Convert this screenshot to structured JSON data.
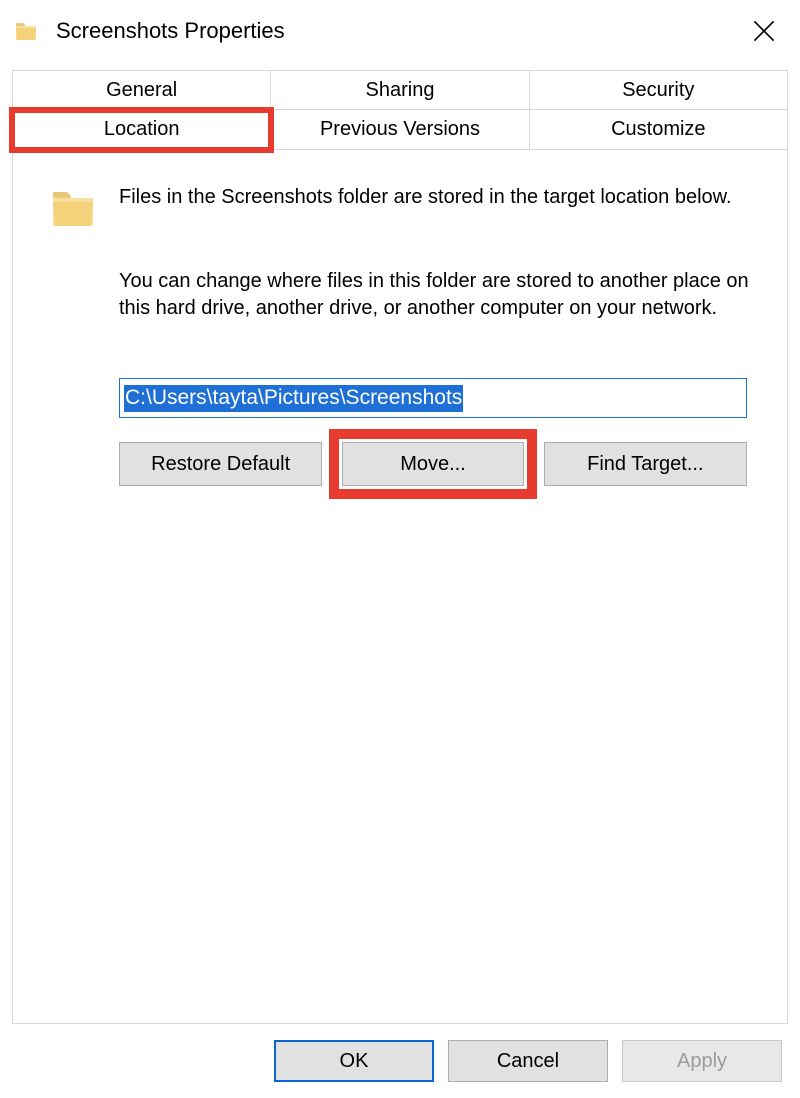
{
  "titlebar": {
    "title": "Screenshots Properties"
  },
  "tabs": {
    "row1": [
      {
        "id": "general",
        "label": "General"
      },
      {
        "id": "sharing",
        "label": "Sharing"
      },
      {
        "id": "security",
        "label": "Security"
      }
    ],
    "row2": [
      {
        "id": "location",
        "label": "Location"
      },
      {
        "id": "previous-versions",
        "label": "Previous Versions"
      },
      {
        "id": "customize",
        "label": "Customize"
      }
    ],
    "active": "location"
  },
  "content": {
    "intro": "Files in the Screenshots folder are stored in the target location below.",
    "description": "You can change where files in this folder are stored to another place on this hard drive, another drive, or another computer on your network.",
    "path_value": "C:\\Users\\tayta\\Pictures\\Screenshots",
    "buttons": {
      "restore": "Restore Default",
      "move": "Move...",
      "find": "Find Target..."
    }
  },
  "footer": {
    "ok": "OK",
    "cancel": "Cancel",
    "apply": "Apply"
  },
  "highlights": {
    "tab": "location",
    "button": "move"
  }
}
